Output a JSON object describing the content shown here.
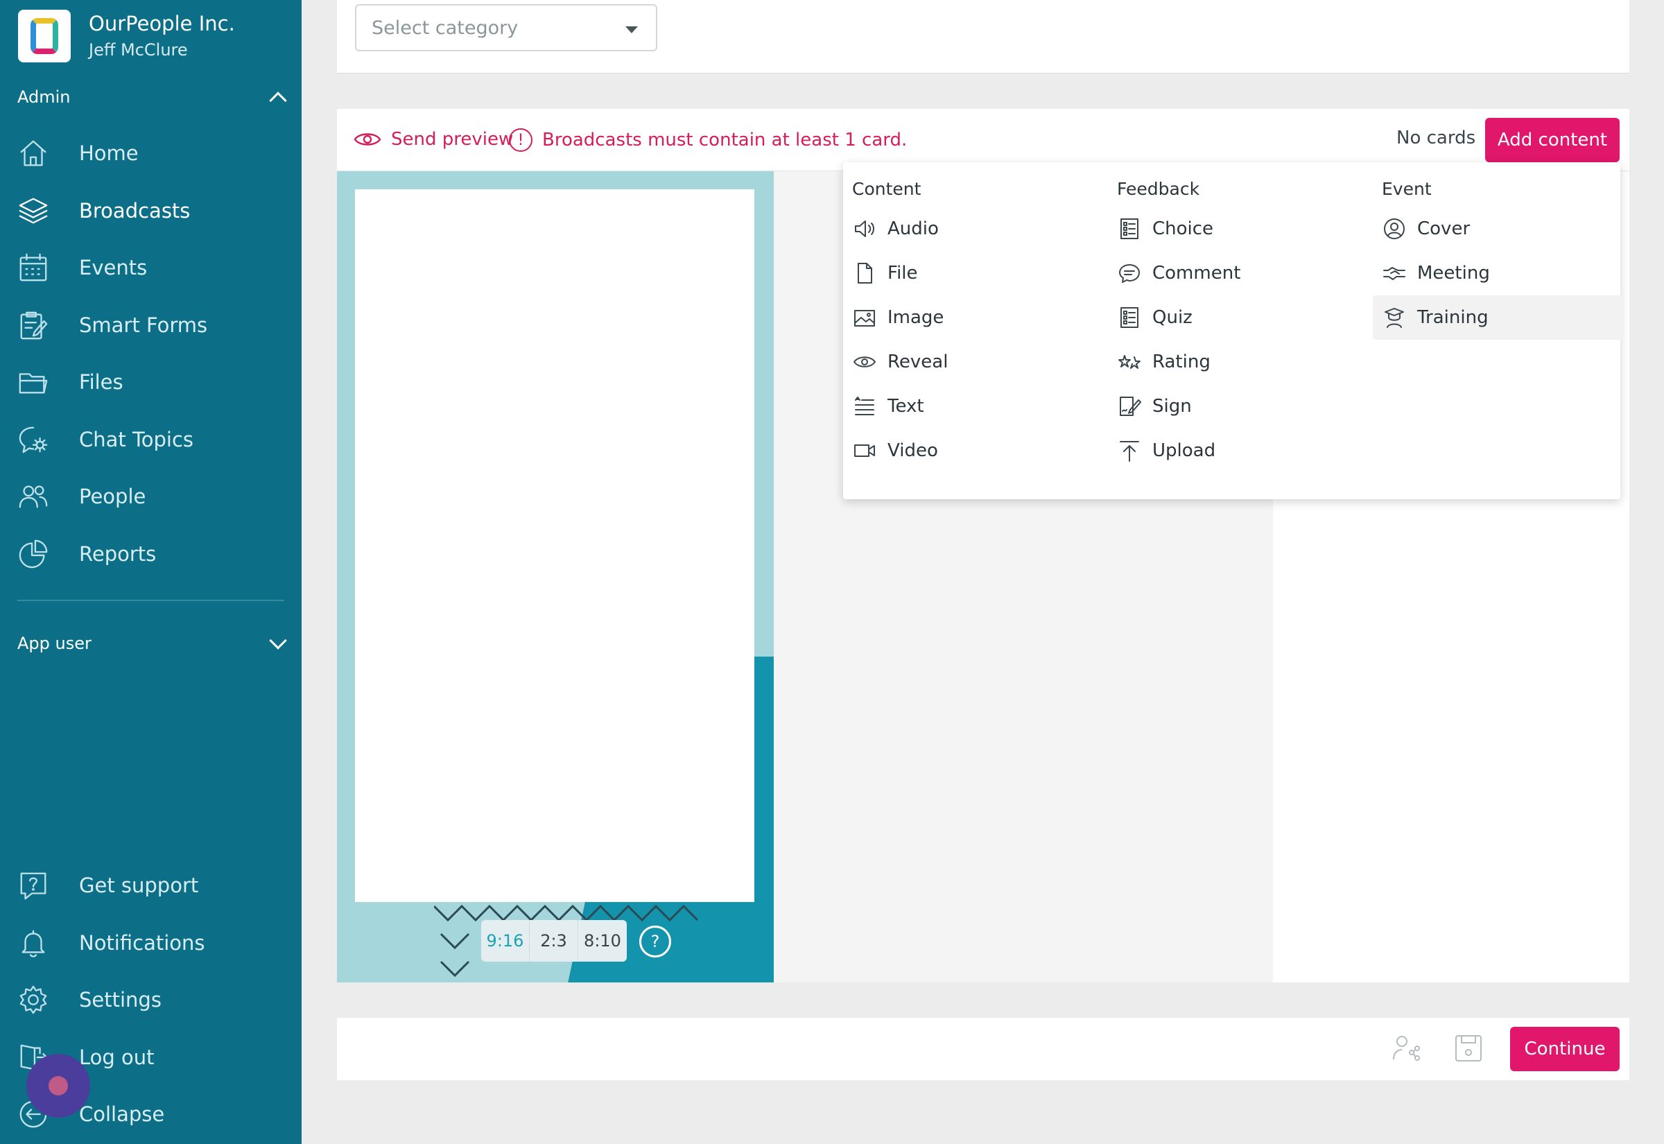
{
  "org": {
    "name": "OurPeople Inc.",
    "user": "Jeff McClure"
  },
  "sidebar": {
    "admin_label": "Admin",
    "items": [
      {
        "label": "Home",
        "icon": "home-icon"
      },
      {
        "label": "Broadcasts",
        "icon": "layers-icon"
      },
      {
        "label": "Events",
        "icon": "calendar-icon"
      },
      {
        "label": "Smart Forms",
        "icon": "form-icon"
      },
      {
        "label": "Files",
        "icon": "folder-icon"
      },
      {
        "label": "Chat Topics",
        "icon": "chat-gear-icon"
      },
      {
        "label": "People",
        "icon": "people-icon"
      },
      {
        "label": "Reports",
        "icon": "pie-chart-icon"
      }
    ],
    "app_user_label": "App user",
    "bottom_items": [
      {
        "label": "Get support",
        "icon": "help-icon"
      },
      {
        "label": "Notifications",
        "icon": "bell-icon"
      },
      {
        "label": "Settings",
        "icon": "gear-icon"
      },
      {
        "label": "Log out",
        "icon": "logout-icon"
      },
      {
        "label": "Collapse",
        "icon": "collapse-icon"
      }
    ]
  },
  "category": {
    "placeholder": "Select category"
  },
  "toolbar": {
    "send_preview": "Send preview",
    "warning": "Broadcasts must contain at least 1 card.",
    "no_cards": "No cards",
    "add_content": "Add content"
  },
  "ratios": [
    "9:16",
    "2:3",
    "8:10"
  ],
  "help_glyph": "?",
  "menu": {
    "content": {
      "title": "Content",
      "items": [
        "Audio",
        "File",
        "Image",
        "Reveal",
        "Text",
        "Video"
      ]
    },
    "feedback": {
      "title": "Feedback",
      "items": [
        "Choice",
        "Comment",
        "Quiz",
        "Rating",
        "Sign",
        "Upload"
      ]
    },
    "event": {
      "title": "Event",
      "items": [
        "Cover",
        "Meeting",
        "Training"
      ]
    }
  },
  "footer": {
    "continue": "Continue"
  },
  "colors": {
    "sidebar": "#0c6f87",
    "accent": "#e0176a",
    "error": "#d61d5a"
  }
}
